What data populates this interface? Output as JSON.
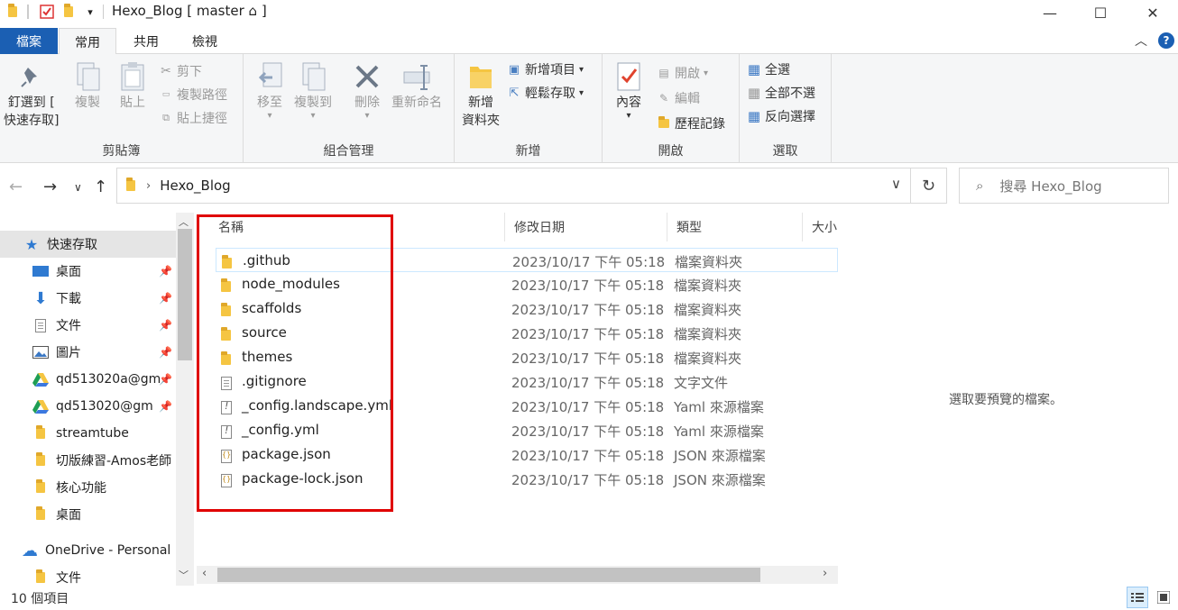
{
  "window": {
    "title": "Hexo_Blog [ master ⌂ ]",
    "minimize": "—",
    "maximize": "☐",
    "close": "✕"
  },
  "tabs": {
    "file": "檔案",
    "home": "常用",
    "share": "共用",
    "view": "檢視"
  },
  "ribbon": {
    "clipboard": {
      "label": "剪貼簿",
      "pin": "釘選到 [",
      "pin2": "快速存取]",
      "copy": "複製",
      "paste": "貼上",
      "cut": "剪下",
      "copy_path": "複製路徑",
      "paste_shortcut": "貼上捷徑"
    },
    "organize": {
      "label": "組合管理",
      "move_to": "移至",
      "copy_to": "複製到",
      "delete": "刪除",
      "rename": "重新命名"
    },
    "new": {
      "label": "新增",
      "new_folder": "新增",
      "new_folder2": "資料夾",
      "new_item": "新增項目",
      "easy_access": "輕鬆存取"
    },
    "open": {
      "label": "開啟",
      "properties": "內容",
      "open": "開啟",
      "edit": "編輯",
      "history": "歷程記錄"
    },
    "select": {
      "label": "選取",
      "select_all": "全選",
      "select_none": "全部不選",
      "invert": "反向選擇"
    }
  },
  "address": {
    "path": "Hexo_Blog",
    "search_placeholder": "搜尋 Hexo_Blog"
  },
  "sidebar": {
    "items": [
      {
        "label": "快速存取",
        "pinned": false
      },
      {
        "label": "桌面",
        "pinned": true
      },
      {
        "label": "下載",
        "pinned": true
      },
      {
        "label": "文件",
        "pinned": true
      },
      {
        "label": "圖片",
        "pinned": true
      },
      {
        "label": "qd513020a@gm",
        "pinned": true
      },
      {
        "label": "qd513020@gm",
        "pinned": true
      },
      {
        "label": "streamtube",
        "pinned": false
      },
      {
        "label": "切版練習-Amos老師",
        "pinned": false
      },
      {
        "label": "核心功能",
        "pinned": false
      },
      {
        "label": "桌面",
        "pinned": false
      },
      {
        "label": "OneDrive - Personal",
        "pinned": false
      },
      {
        "label": "文件",
        "pinned": false
      }
    ]
  },
  "columns": {
    "name": "名稱",
    "date": "修改日期",
    "type": "類型",
    "size": "大小"
  },
  "files": [
    {
      "name": ".github",
      "date": "2023/10/17 下午 05:18",
      "type": "檔案資料夾",
      "icon": "folder"
    },
    {
      "name": "node_modules",
      "date": "2023/10/17 下午 05:18",
      "type": "檔案資料夾",
      "icon": "folder"
    },
    {
      "name": "scaffolds",
      "date": "2023/10/17 下午 05:18",
      "type": "檔案資料夾",
      "icon": "folder"
    },
    {
      "name": "source",
      "date": "2023/10/17 下午 05:18",
      "type": "檔案資料夾",
      "icon": "folder"
    },
    {
      "name": "themes",
      "date": "2023/10/17 下午 05:18",
      "type": "檔案資料夾",
      "icon": "folder"
    },
    {
      "name": ".gitignore",
      "date": "2023/10/17 下午 05:18",
      "type": "文字文件",
      "icon": "text"
    },
    {
      "name": "_config.landscape.yml",
      "date": "2023/10/17 下午 05:18",
      "type": "Yaml 來源檔案",
      "icon": "yml"
    },
    {
      "name": "_config.yml",
      "date": "2023/10/17 下午 05:18",
      "type": "Yaml 來源檔案",
      "icon": "yml"
    },
    {
      "name": "package.json",
      "date": "2023/10/17 下午 05:18",
      "type": "JSON 來源檔案",
      "icon": "json"
    },
    {
      "name": "package-lock.json",
      "date": "2023/10/17 下午 05:18",
      "type": "JSON 來源檔案",
      "icon": "json"
    }
  ],
  "preview": {
    "text": "選取要預覽的檔案。"
  },
  "status": {
    "count": "10 個項目"
  },
  "colors": {
    "accent": "#1b5fb3",
    "highlight_box": "#e00000",
    "folder": "#f5c542"
  }
}
